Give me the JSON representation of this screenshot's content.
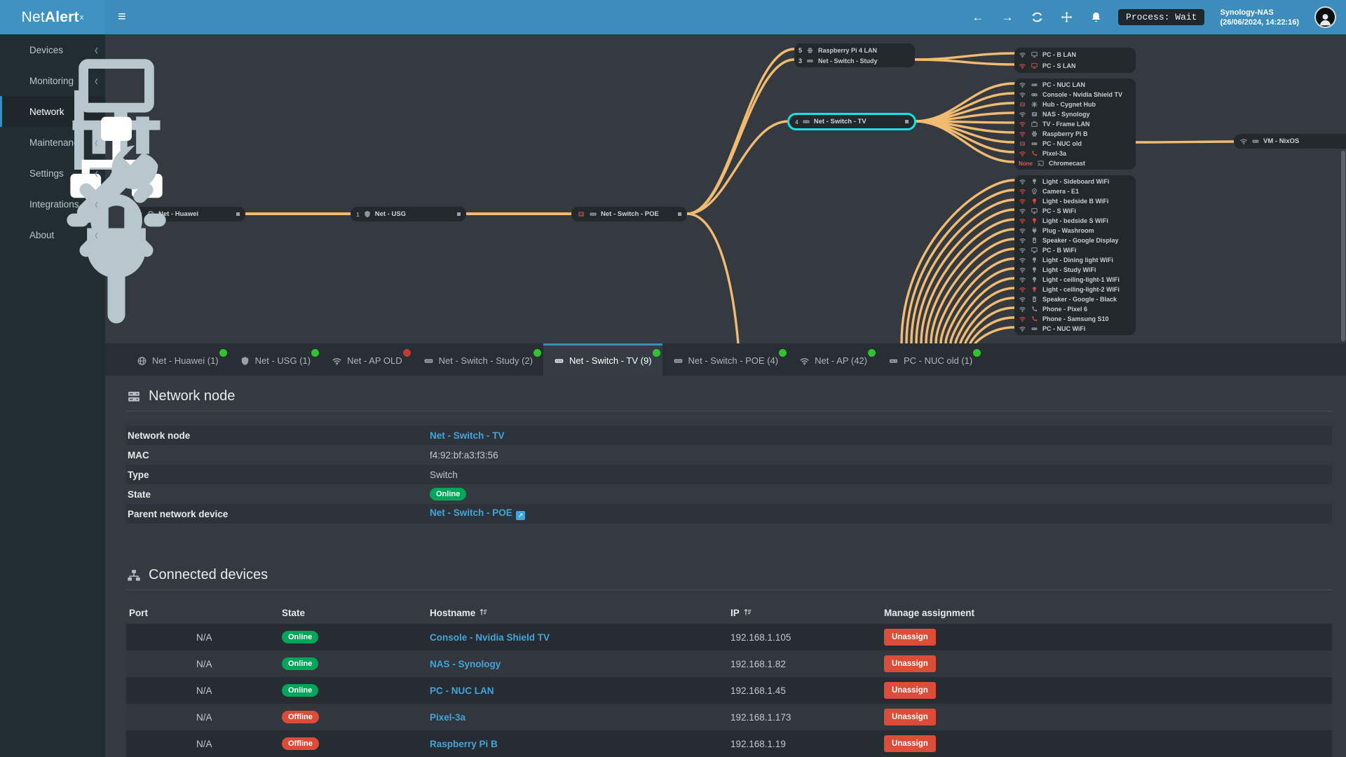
{
  "topbar": {
    "logo_prefix": "Net",
    "logo_bold": "Alert",
    "logo_sup": "x",
    "process_badge": "Process: Wait",
    "host": "Synology-NAS",
    "timestamp": "(26/06/2024, 14:22:16)"
  },
  "sidebar": {
    "items": [
      {
        "label": "Devices",
        "icon": "laptop-icon"
      },
      {
        "label": "Monitoring",
        "icon": "chart-icon"
      },
      {
        "label": "Network",
        "icon": "sitemap-icon"
      },
      {
        "label": "Maintenance",
        "icon": "wrench-icon"
      },
      {
        "label": "Settings",
        "icon": "gear-icon"
      },
      {
        "label": "Integrations",
        "icon": "plug-icon"
      },
      {
        "label": "About",
        "icon": "info-icon"
      }
    ]
  },
  "topology": {
    "chain": [
      {
        "name": "Net - Huawei"
      },
      {
        "port": "1",
        "name": "Net - USG"
      },
      {
        "name": "Net - Switch - POE"
      }
    ],
    "study_group": [
      {
        "port": "5",
        "name": "Raspberry Pi 4 LAN"
      },
      {
        "port": "3",
        "name": "Net - Switch - Study"
      }
    ],
    "tv_node": {
      "port": "4",
      "name": "Net - Switch - TV"
    },
    "vm_node": {
      "name": "VM - NixOS"
    },
    "group1": [
      {
        "name": "PC - B LAN",
        "status": "gray"
      },
      {
        "name": "PC - S LAN",
        "status": "red"
      }
    ],
    "group2": [
      {
        "name": "PC - NUC LAN",
        "status": "gray"
      },
      {
        "name": "Console - Nvidia Shield TV",
        "status": "gray"
      },
      {
        "name": "Hub - Cygnet Hub",
        "status": "dark"
      },
      {
        "name": "NAS - Synology",
        "status": "gray"
      },
      {
        "name": "TV - Frame LAN",
        "status": "red"
      },
      {
        "name": "Raspberry Pi B",
        "status": "red"
      },
      {
        "name": "PC - NUC old",
        "status": "gray"
      },
      {
        "name": "Pixel-3a",
        "status": "red"
      },
      {
        "port": "None",
        "name": "Chromecast",
        "status": "red"
      }
    ],
    "group3": [
      {
        "name": "Light - Sideboard WiFi",
        "status": "gray"
      },
      {
        "name": "Camera - E1",
        "status": "red"
      },
      {
        "name": "Light - bedside B WiFi",
        "status": "red"
      },
      {
        "name": "PC - S WiFi",
        "status": "gray"
      },
      {
        "name": "Light - bedside S WiFi",
        "status": "red"
      },
      {
        "name": "Plug - Washroom",
        "status": "gray"
      },
      {
        "name": "Speaker - Google Display",
        "status": "gray"
      },
      {
        "name": "PC - B WiFi",
        "status": "gray"
      },
      {
        "name": "Light - Dining light WiFi",
        "status": "gray"
      },
      {
        "name": "Light - Study WiFi",
        "status": "gray"
      },
      {
        "name": "Light - ceiling-light-1 WiFi",
        "status": "gray"
      },
      {
        "name": "Light - ceiling-light-2 WiFi",
        "status": "red"
      },
      {
        "name": "Speaker - Google - Black",
        "status": "gray"
      },
      {
        "name": "Phone - Pixel 6",
        "status": "gray"
      },
      {
        "name": "Phone - Samsung S10",
        "status": "red"
      },
      {
        "name": "PC - NUC WiFi",
        "status": "gray"
      }
    ]
  },
  "tabs": [
    {
      "label": "Net - Huawei (1)",
      "dot": "green"
    },
    {
      "label": "Net - USG (1)",
      "dot": "green"
    },
    {
      "label": "Net - AP OLD",
      "dot": "red"
    },
    {
      "label": "Net - Switch - Study (2)",
      "dot": "green"
    },
    {
      "label": "Net - Switch - TV (9)",
      "dot": "green",
      "active": true
    },
    {
      "label": "Net - Switch - POE (4)",
      "dot": "green"
    },
    {
      "label": "Net - AP (42)",
      "dot": "green"
    },
    {
      "label": "PC - NUC old (1)",
      "dot": "green"
    }
  ],
  "node_section": {
    "title": "Network node",
    "rows": {
      "node_label": "Network node",
      "node_value": "Net - Switch - TV",
      "mac_label": "MAC",
      "mac_value": "f4:92:bf:a3:f3:56",
      "type_label": "Type",
      "type_value": "Switch",
      "state_label": "State",
      "state_value": "Online",
      "parent_label": "Parent network device",
      "parent_value": "Net - Switch - POE"
    }
  },
  "devices_section": {
    "title": "Connected devices",
    "columns": {
      "port": "Port",
      "state": "State",
      "hostname": "Hostname",
      "ip": "IP",
      "manage": "Manage assignment"
    },
    "rows": [
      {
        "port": "N/A",
        "state": "Online",
        "hostname": "Console - Nvidia Shield TV",
        "ip": "192.168.1.105",
        "action": "Unassign"
      },
      {
        "port": "N/A",
        "state": "Online",
        "hostname": "NAS - Synology",
        "ip": "192.168.1.82",
        "action": "Unassign"
      },
      {
        "port": "N/A",
        "state": "Online",
        "hostname": "PC - NUC LAN",
        "ip": "192.168.1.45",
        "action": "Unassign"
      },
      {
        "port": "N/A",
        "state": "Offline",
        "hostname": "Pixel-3a",
        "ip": "192.168.1.173",
        "action": "Unassign"
      },
      {
        "port": "N/A",
        "state": "Offline",
        "hostname": "Raspberry Pi B",
        "ip": "192.168.1.19",
        "action": "Unassign"
      }
    ]
  },
  "colors": {
    "accent": "#3c8dbc",
    "link": "#41a5dc",
    "online": "#00a65a",
    "offline": "#dd4b39",
    "line": "#f2bb72",
    "selection": "#19e0e8",
    "dot_green": "#2fc52f",
    "dot_red": "#c23b2e"
  }
}
